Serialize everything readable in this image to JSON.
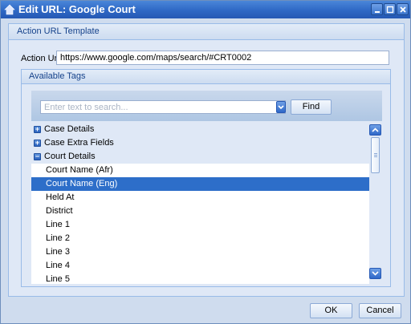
{
  "window": {
    "title": "Edit URL: Google Court"
  },
  "template_section": {
    "title": "Action URL Template"
  },
  "action_url": {
    "label": "Action Url",
    "value": "https://www.google.com/maps/search/#CRT0002"
  },
  "tags_section": {
    "title": "Available Tags"
  },
  "search": {
    "placeholder": "Enter text to search...",
    "find_label": "Find"
  },
  "tree": {
    "groups": [
      {
        "label": "Case Details",
        "expanded": false
      },
      {
        "label": "Case Extra Fields",
        "expanded": false
      },
      {
        "label": "Court Details",
        "expanded": true
      }
    ],
    "court_items": [
      "Court Name (Afr)",
      "Court Name (Eng)",
      "Held At",
      "District",
      "Line 1",
      "Line 2",
      "Line 3",
      "Line 4",
      "Line 5"
    ],
    "selected_item": "Court Name (Eng)"
  },
  "buttons": {
    "ok": "OK",
    "cancel": "Cancel"
  },
  "colors": {
    "titlebar": "#2e68c5",
    "selection": "#2d6ec9",
    "panel": "#dfe8f6"
  }
}
